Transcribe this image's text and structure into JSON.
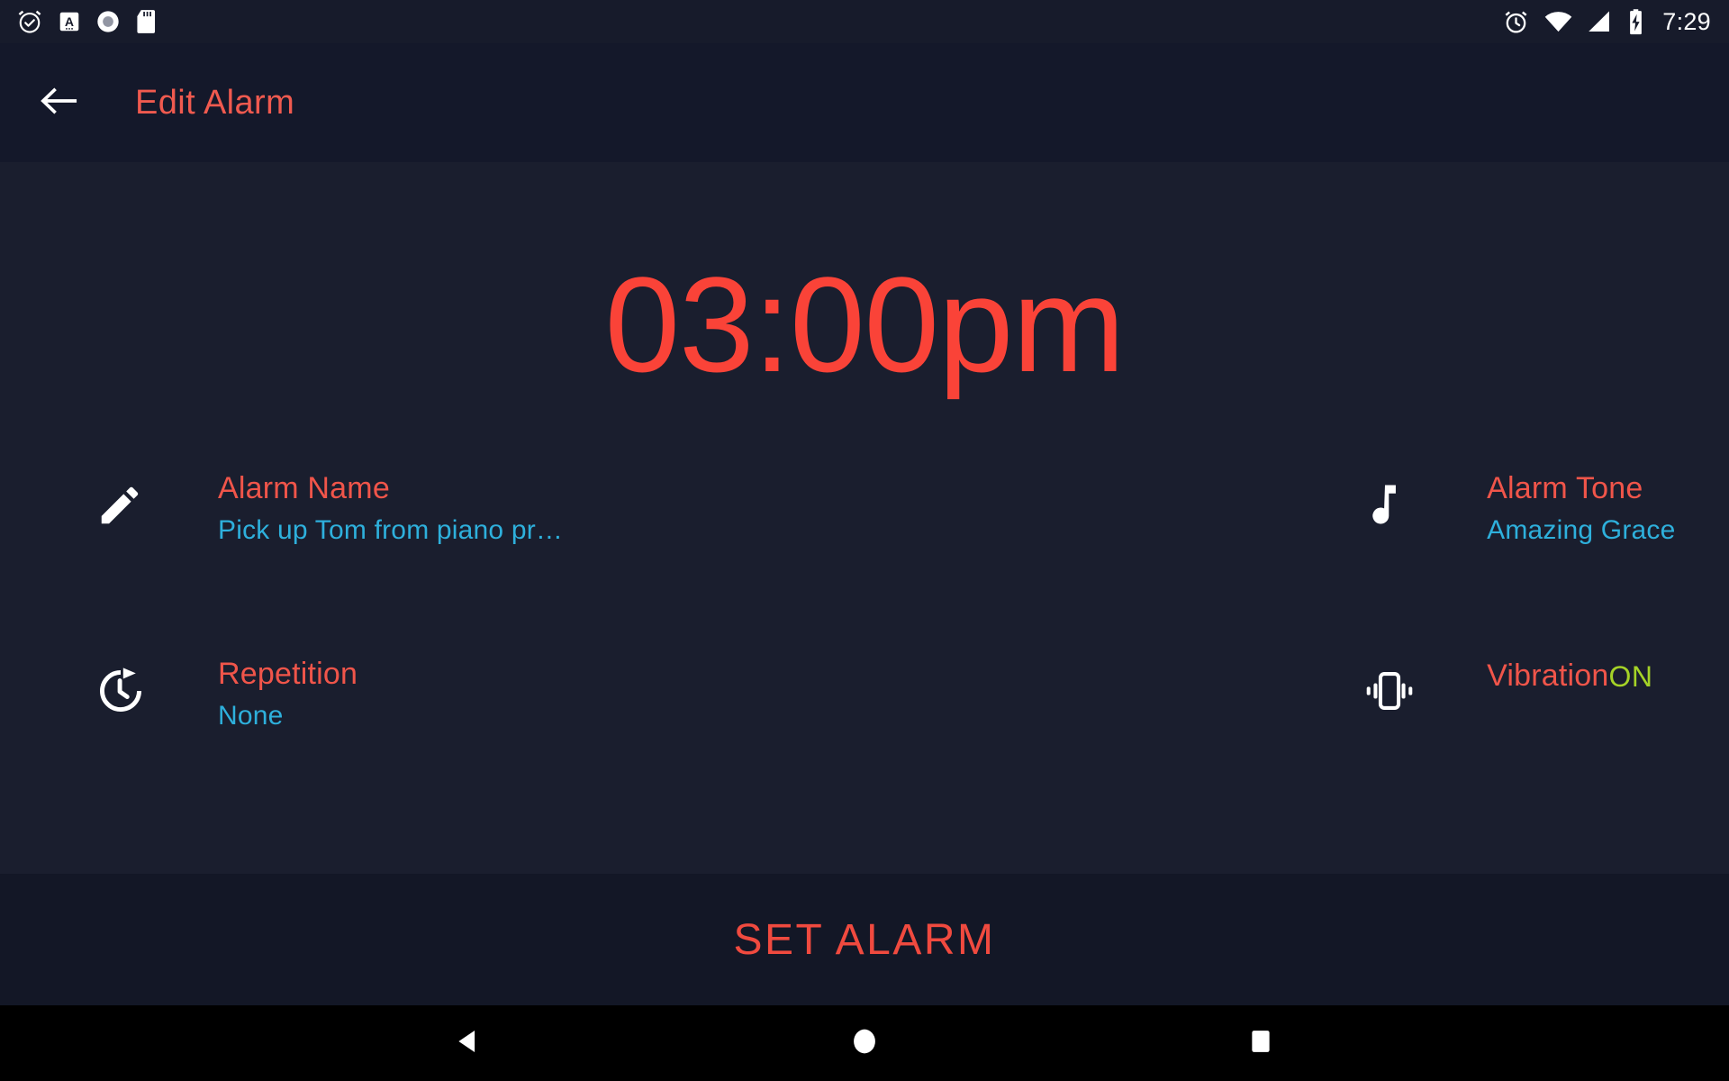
{
  "status_bar": {
    "left_icons": [
      {
        "name": "alarm-set-icon",
        "label": "alarm-clock-check"
      },
      {
        "name": "keyboard-icon",
        "label": "keyboard-A"
      },
      {
        "name": "record-circle-icon",
        "label": "record-circle"
      },
      {
        "name": "sd-card-icon",
        "label": "sd-card"
      }
    ],
    "right_icons": [
      {
        "name": "alarm-icon",
        "label": "alarm-clock"
      },
      {
        "name": "wifi-icon",
        "label": "wifi"
      },
      {
        "name": "cellular-signal-icon",
        "label": "cellular-signal"
      },
      {
        "name": "battery-charging-icon",
        "label": "battery-charging"
      }
    ],
    "time": "7:29"
  },
  "toolbar": {
    "back_label": "back",
    "title": "Edit Alarm"
  },
  "alarm": {
    "time": "03:00pm"
  },
  "options": [
    {
      "key": "alarm_name",
      "icon": "pencil-icon",
      "title": "Alarm Name",
      "value": "Pick up Tom from piano pr…"
    },
    {
      "key": "alarm_tone",
      "icon": "music-note-icon",
      "title": "Alarm Tone",
      "value": "Amazing Grace"
    },
    {
      "key": "repetition",
      "icon": "repeat-clock-icon",
      "title": "Repetition",
      "value": "None"
    },
    {
      "key": "vibration",
      "icon": "vibration-icon",
      "title": "Vibration",
      "state": "ON"
    }
  ],
  "footer": {
    "set_alarm_label": "SET ALARM"
  },
  "nav_bar": {
    "back": "back",
    "home": "home",
    "recents": "recents"
  },
  "colors": {
    "accent_red": "#f0554a",
    "time_red": "#fa4338",
    "value_blue": "#2eb0dc",
    "on_green": "#a5d327",
    "bg_content": "#1a1e2e",
    "bg_toolbar": "#14182a",
    "bg_footer": "#131726",
    "bg_status": "#171b2b",
    "bg_nav": "#000000"
  }
}
